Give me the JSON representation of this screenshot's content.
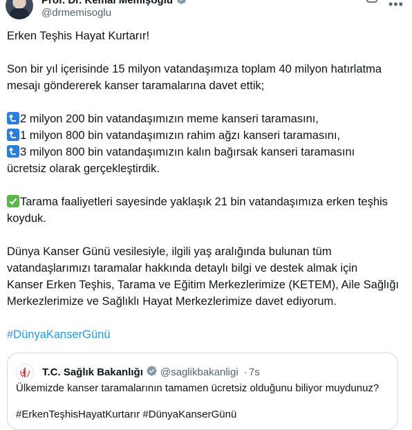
{
  "author": {
    "name": "Prof. Dr. Kemal Memişoğlu",
    "handle": "@drmemisoglu"
  },
  "tweet": {
    "line_intro": "Erken Teşhis Hayat Kurtarır!",
    "para2_line1": "Son bir yıl içerisinde 15 milyon vatandaşımıza toplam 40 milyon hatırlatma",
    "para2_line2": "mesajı göndererek kanser taramalarına davet ettik;",
    "list_item_1": "2 milyon 200 bin vatandaşımızın meme kanseri taramasını,",
    "list_item_2": "1 milyon 800 bin vatandaşımızın rahim ağzı kanseri taramasını,",
    "list_item_3": "3 milyon 800 bin vatandaşımızın kalın bağırsak kanseri taramasını",
    "list_item_4": "ücretsiz olarak gerçekleştirdik.",
    "check_line1": "Tarama faaliyetleri sayesinde yaklaşık 21 bin vatandaşımıza erken teşhis",
    "check_line2": "koyduk.",
    "para5_line1": "Dünya Kanser Günü vesilesiyle, ilgili yaş aralığında bulunan tüm",
    "para5_line2": "vatandaşlarımızı taramalar hakkında detaylı bilgi ve destek almak için",
    "para5_line3": "Kanser Erken Teşhis, Tarama ve Eğitim Merkezlerimize (KETEM), Aile Sağlığı",
    "para5_line4": "Merkezlerimize ve Sağlıklı Hayat Merkezlerimize davet ediyorum.",
    "hashtag": "#DünyaKanserGünü"
  },
  "quoted": {
    "name": "T.C. Sağlık Bakanlığı",
    "handle": "@saglikbakanligi",
    "separator": "·",
    "time": "7s",
    "text": "Ülkemizde kanser taramalarının tamamen ücretsiz olduğunu biliyor muydunuz?",
    "hashtags": "#ErkenTeşhisHayatKurtarır #DünyaKanserGünü"
  },
  "colors": {
    "accent": "#1d9bf0",
    "verified": "#829aab",
    "muted": "#536471"
  },
  "icons": [
    "verified-badge-icon",
    "grok-icon",
    "more-options-icon",
    "return-arrow-emoji",
    "check-mark-emoji"
  ]
}
